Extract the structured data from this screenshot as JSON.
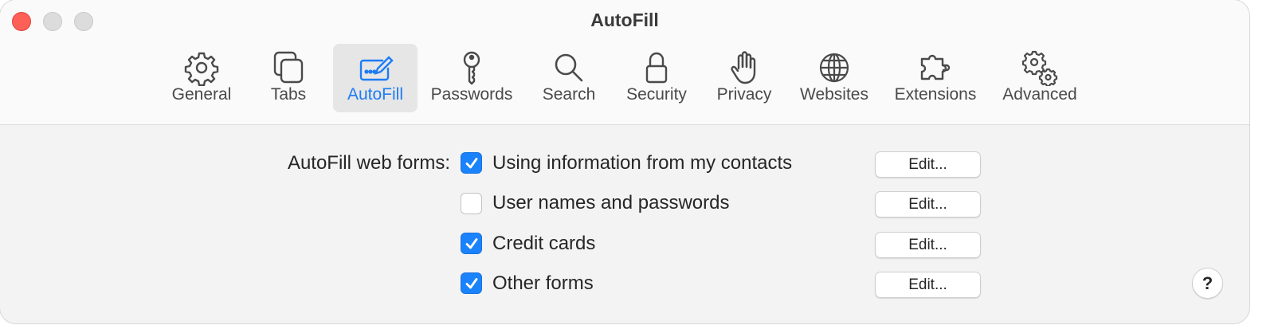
{
  "window": {
    "title": "AutoFill"
  },
  "toolbar": {
    "items": [
      {
        "label": "General",
        "icon": "gear-icon"
      },
      {
        "label": "Tabs",
        "icon": "tabs-icon"
      },
      {
        "label": "AutoFill",
        "icon": "autofill-icon",
        "selected": true
      },
      {
        "label": "Passwords",
        "icon": "key-icon"
      },
      {
        "label": "Search",
        "icon": "magnifier-icon"
      },
      {
        "label": "Security",
        "icon": "lock-icon"
      },
      {
        "label": "Privacy",
        "icon": "hand-icon"
      },
      {
        "label": "Websites",
        "icon": "globe-icon"
      },
      {
        "label": "Extensions",
        "icon": "puzzle-icon"
      },
      {
        "label": "Advanced",
        "icon": "gears-icon"
      }
    ]
  },
  "autofill": {
    "label": "AutoFill web forms:",
    "options": [
      {
        "label": "Using information from my contacts",
        "checked": true,
        "button": "Edit..."
      },
      {
        "label": "User names and passwords",
        "checked": false,
        "button": "Edit..."
      },
      {
        "label": "Credit cards",
        "checked": true,
        "button": "Edit..."
      },
      {
        "label": "Other forms",
        "checked": true,
        "button": "Edit..."
      }
    ]
  },
  "help": {
    "label": "?"
  },
  "colors": {
    "accent": "#1a82fb",
    "selected_text": "#1e7cf5",
    "close": "#fe5f57"
  }
}
